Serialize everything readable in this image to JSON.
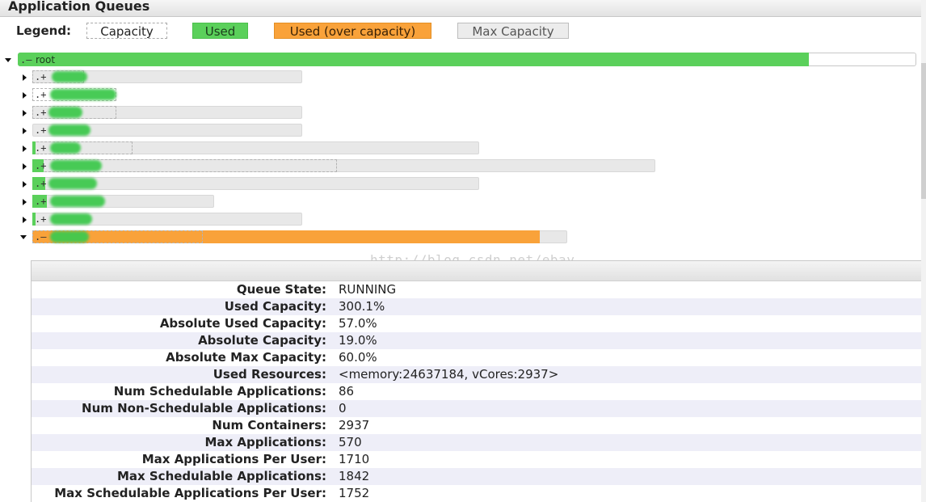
{
  "header": {
    "title": "Application Queues"
  },
  "legend": {
    "label": "Legend:",
    "capacity": "Capacity",
    "used": "Used",
    "over": "Used (over capacity)",
    "max": "Max Capacity"
  },
  "colors": {
    "used": "#5bd05b",
    "over_capacity": "#f9a23a",
    "max": "#ececec"
  },
  "tree": {
    "root_label": "root",
    "root_used_fraction": 0.88
  },
  "watermark": "http://blog.csdn.net/ebay",
  "details": [
    {
      "label": "Queue State:",
      "value": "RUNNING"
    },
    {
      "label": "Used Capacity:",
      "value": "300.1%"
    },
    {
      "label": "Absolute Used Capacity:",
      "value": "57.0%"
    },
    {
      "label": "Absolute Capacity:",
      "value": "19.0%"
    },
    {
      "label": "Absolute Max Capacity:",
      "value": "60.0%"
    },
    {
      "label": "Used Resources:",
      "value": "<memory:24637184, vCores:2937>"
    },
    {
      "label": "Num Schedulable Applications:",
      "value": "86"
    },
    {
      "label": "Num Non-Schedulable Applications:",
      "value": "0"
    },
    {
      "label": "Num Containers:",
      "value": "2937"
    },
    {
      "label": "Max Applications:",
      "value": "570"
    },
    {
      "label": "Max Applications Per User:",
      "value": "1710"
    },
    {
      "label": "Max Schedulable Applications:",
      "value": "1842"
    },
    {
      "label": "Max Schedulable Applications Per User:",
      "value": "1752"
    }
  ]
}
